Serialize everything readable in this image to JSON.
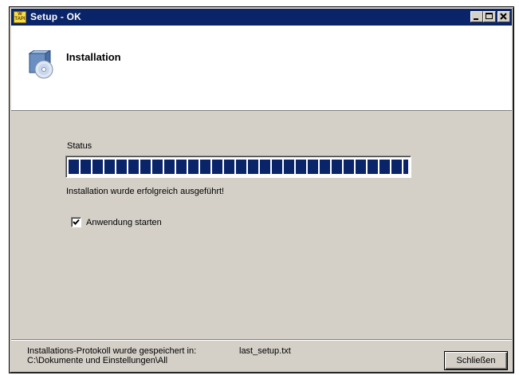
{
  "window": {
    "title": "Setup - OK",
    "app_icon_text": "W TAPI",
    "controls": {
      "minimize": "_",
      "maximize": "□",
      "close": "✕"
    }
  },
  "header": {
    "title": "Installation",
    "icon": "setup-cd-icon"
  },
  "main": {
    "status_label": "Status",
    "progress_value": 1.0,
    "result_message": "Installation wurde erfolgreich ausgeführt!",
    "checkbox": {
      "label": "Anwendung starten",
      "checked": true
    }
  },
  "footer": {
    "log_label": "Installations-Protokoll wurde gespeichert in:",
    "log_path": "C:\\Dokumente und Einstellungen\\All",
    "log_file": "last_setup.txt",
    "close_button": "Schließen"
  },
  "colors": {
    "titlebar": "#0a246a",
    "progress": "#0a246a",
    "face": "#d4d0c8"
  }
}
